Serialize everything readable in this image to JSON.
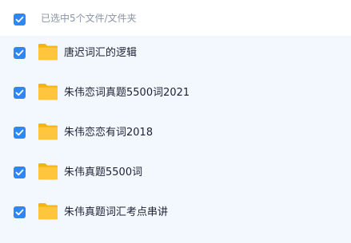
{
  "header": {
    "selection_text": "已选中5个文件/文件夹",
    "checked": true
  },
  "colors": {
    "accent": "#2f86f6",
    "folder": "#ffc53d",
    "list_background": "#f3f8ff"
  },
  "items": [
    {
      "name": "唐迟词汇的逻辑",
      "checked": true,
      "icon": "folder-icon"
    },
    {
      "name": "朱伟恋词真题5500词2021",
      "checked": true,
      "icon": "folder-icon"
    },
    {
      "name": "朱伟恋恋有词2018",
      "checked": true,
      "icon": "folder-icon"
    },
    {
      "name": "朱伟真题5500词",
      "checked": true,
      "icon": "folder-icon"
    },
    {
      "name": "朱伟真题词汇考点串讲",
      "checked": true,
      "icon": "folder-icon"
    }
  ]
}
